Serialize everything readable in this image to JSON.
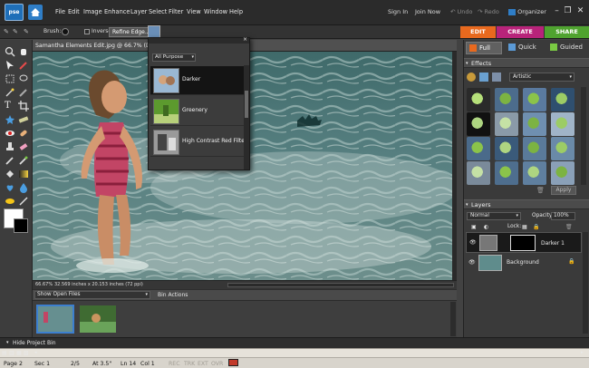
{
  "menubar": {
    "app_icon_label": "pse",
    "items": [
      "File",
      "Edit",
      "Image",
      "Enhance",
      "Layer",
      "Select",
      "Filter",
      "View",
      "Window",
      "Help"
    ],
    "sign_in": "Sign In",
    "join_now": "Join Now",
    "undo": "Undo",
    "redo": "Redo",
    "organizer": "Organizer"
  },
  "options": {
    "brush_label": "Brush:",
    "inverse_label": "Inverse",
    "refine_edge": "Refine Edge..."
  },
  "modes": {
    "edit": "EDIT",
    "create": "CREATE",
    "share": "SHARE"
  },
  "document": {
    "title": "Samantha Elements Edit.jpg @ 66.7% (Darker 1,",
    "zoom": "66.67%",
    "doc_size": "32.569 inches x 20.153 inches (72 ppi)"
  },
  "bin": {
    "show_files": "Show Open Files",
    "bin_actions": "Bin Actions"
  },
  "filter_popup": {
    "category": "All Purpose",
    "items": [
      {
        "label": "Darker"
      },
      {
        "label": "Greenery"
      },
      {
        "label": "High Contrast Red Filter"
      }
    ]
  },
  "panel_tabs": {
    "full": "Full",
    "quick": "Quick",
    "guided": "Guided"
  },
  "effects": {
    "title": "Effects",
    "category": "Artistic",
    "apply": "Apply"
  },
  "layers": {
    "title": "Layers",
    "blend": "Normal",
    "opacity_label": "Opacity:",
    "opacity_value": "100%",
    "lock_label": "Lock:",
    "layer_items": [
      {
        "name": "Darker 1"
      },
      {
        "name": "Background"
      }
    ]
  },
  "hide_bin": "Hide Project Bin",
  "wp_status": {
    "page": "Page  2",
    "sec": "Sec  1",
    "pages": "2/5",
    "at": "At  3.5\"",
    "ln": "Ln  14",
    "col": "Col  1",
    "rec": "REC",
    "trk": "TRK",
    "ext": "EXT",
    "ovr": "OVR"
  },
  "colors": {
    "edit_tab": "#e8691e",
    "create_tab": "#b8237a",
    "share_tab": "#4fa32f",
    "accent_blue": "#1f6fb8"
  }
}
